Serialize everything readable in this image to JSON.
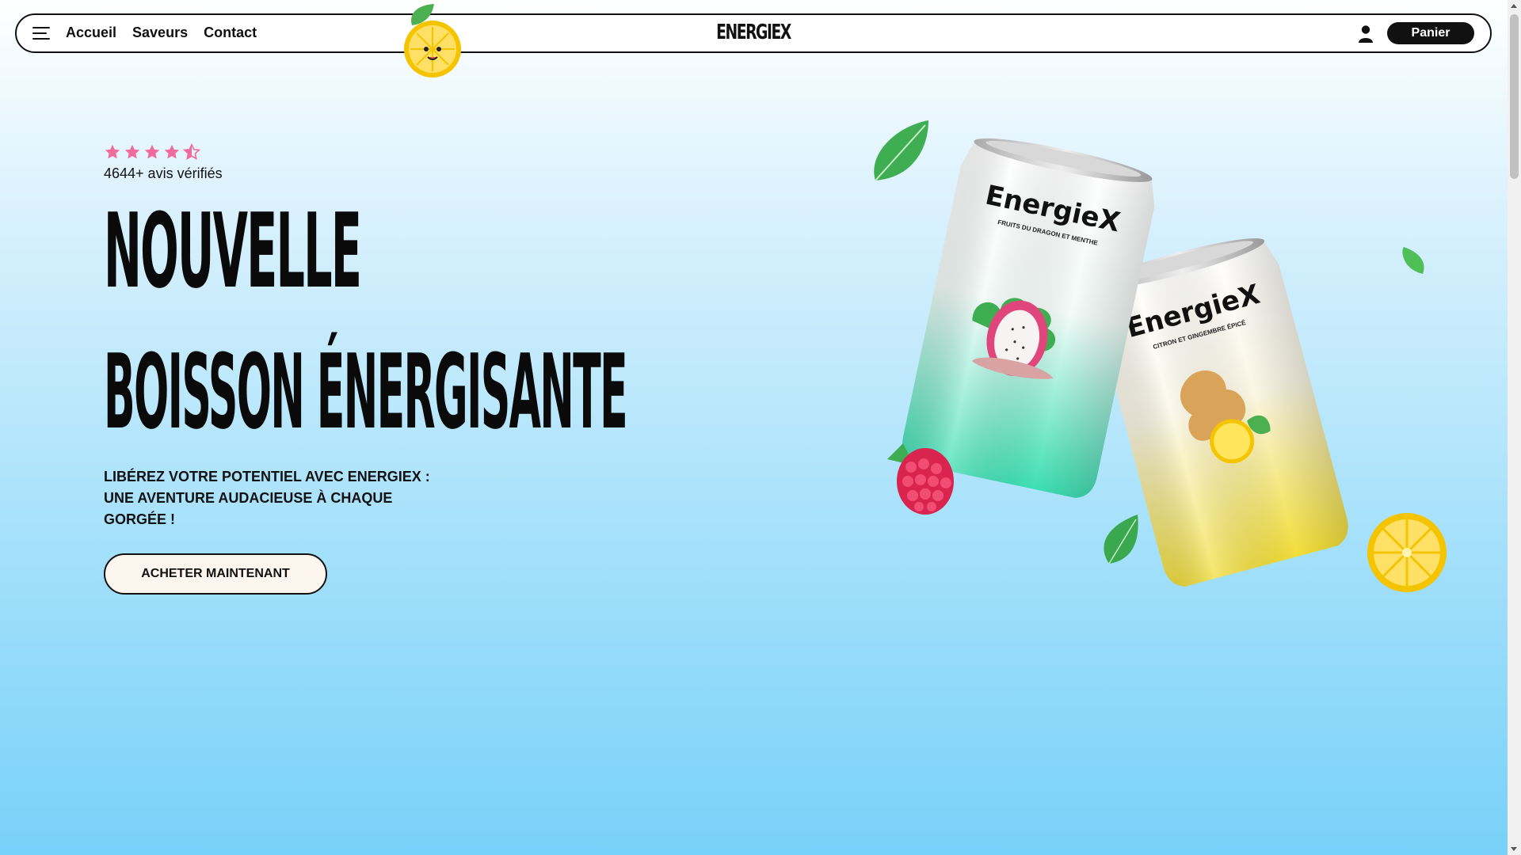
{
  "nav": {
    "links": [
      "Accueil",
      "Saveurs",
      "Contact"
    ],
    "logo": "ENERGIEX",
    "cart_label": "Panier"
  },
  "hero": {
    "rating": 4.5,
    "reviews": "4644+ avis vérifiés",
    "headline_line1": "NOUVELLE",
    "headline_line2": "BOISSON ÉNERGISANTE",
    "subtitle": "Libérez votre potentiel avec EnergieX : une aventure audacieuse à chaque gorgée !",
    "cta_label": "ACHETER MAINTENANT"
  },
  "cans": [
    {
      "brand": "EnergieX",
      "flavor": "FRUITS DU DRAGON ET MENTHE"
    },
    {
      "brand": "EnergieX",
      "flavor": "CITRON ET GINGEMBRE ÉPICÉ"
    }
  ],
  "colors": {
    "star": "#f06c9b",
    "accent_dark": "#111111",
    "can_green": "#3fe0b5",
    "can_yellow": "#f2de3a"
  }
}
